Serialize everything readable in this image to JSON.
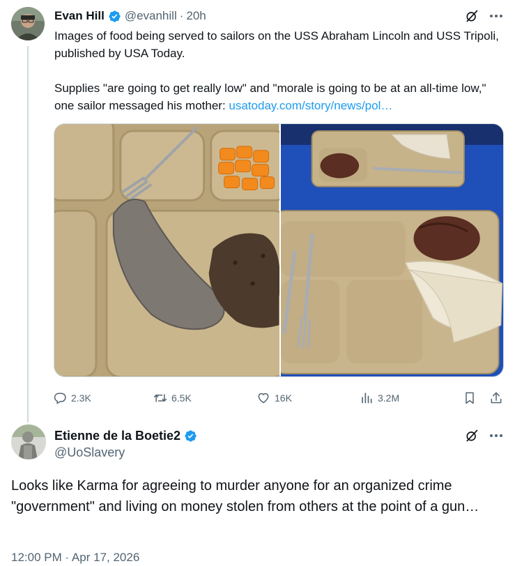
{
  "parent_tweet": {
    "author_name": "Evan Hill",
    "handle": "@evanhill",
    "separator": "·",
    "time": "20h",
    "text_paragraph_1": "Images of food being served to sailors on the USS Abraham Lincoln and USS Tripoli, published by USA Today.",
    "text_paragraph_2": "Supplies \"are going to get really low\" and \"morale is going to be at an all-time low,\" one sailor messaged his mother: ",
    "link_text": "usatoday.com/story/news/pol…",
    "stats": {
      "replies": "2.3K",
      "retweets": "6.5K",
      "likes": "16K",
      "views": "3.2M"
    }
  },
  "reply_tweet": {
    "author_name": "Etienne de la Boetie2",
    "handle": "@UoSlavery",
    "text": "Looks like Karma for agreeing to murder anyone for an organized crime \"government\" and living on money stolen from others at the point of a gun…",
    "timestamp": "12:00 PM · Apr 17, 2026"
  },
  "colors": {
    "accent": "#1d9bf0",
    "secondary_text": "#536471",
    "primary_text": "#0f1419",
    "tray": "#c9b58e",
    "table_blue": "#1f4fb8"
  },
  "icons": [
    "grok-icon",
    "more-icon",
    "verified-badge-icon",
    "reply-icon",
    "retweet-icon",
    "like-icon",
    "views-icon",
    "bookmark-icon",
    "share-icon"
  ]
}
